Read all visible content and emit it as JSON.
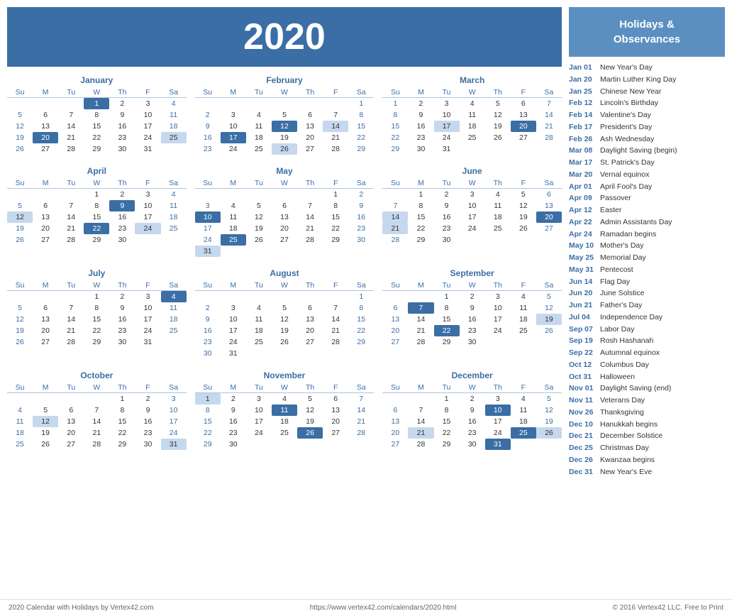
{
  "header": {
    "year": "2020"
  },
  "holidays_header": "Holidays &\nObservances",
  "holidays": [
    {
      "date": "Jan 01",
      "name": "New Year's Day"
    },
    {
      "date": "Jan 20",
      "name": "Martin Luther King Day"
    },
    {
      "date": "Jan 25",
      "name": "Chinese New Year"
    },
    {
      "date": "Feb 12",
      "name": "Lincoln's Birthday"
    },
    {
      "date": "Feb 14",
      "name": "Valentine's Day"
    },
    {
      "date": "Feb 17",
      "name": "President's Day"
    },
    {
      "date": "Feb 26",
      "name": "Ash Wednesday"
    },
    {
      "date": "Mar 08",
      "name": "Daylight Saving (begin)"
    },
    {
      "date": "Mar 17",
      "name": "St. Patrick's Day"
    },
    {
      "date": "Mar 20",
      "name": "Vernal equinox"
    },
    {
      "date": "Apr 01",
      "name": "April Fool's Day"
    },
    {
      "date": "Apr 09",
      "name": "Passover"
    },
    {
      "date": "Apr 12",
      "name": "Easter"
    },
    {
      "date": "Apr 22",
      "name": "Admin Assistants Day"
    },
    {
      "date": "Apr 24",
      "name": "Ramadan begins"
    },
    {
      "date": "May 10",
      "name": "Mother's Day"
    },
    {
      "date": "May 25",
      "name": "Memorial Day"
    },
    {
      "date": "May 31",
      "name": "Pentecost"
    },
    {
      "date": "Jun 14",
      "name": "Flag Day"
    },
    {
      "date": "Jun 20",
      "name": "June Solstice"
    },
    {
      "date": "Jun 21",
      "name": "Father's Day"
    },
    {
      "date": "Jul 04",
      "name": "Independence Day"
    },
    {
      "date": "Sep 07",
      "name": "Labor Day"
    },
    {
      "date": "Sep 19",
      "name": "Rosh Hashanah"
    },
    {
      "date": "Sep 22",
      "name": "Autumnal equinox"
    },
    {
      "date": "Oct 12",
      "name": "Columbus Day"
    },
    {
      "date": "Oct 31",
      "name": "Halloween"
    },
    {
      "date": "Nov 01",
      "name": "Daylight Saving (end)"
    },
    {
      "date": "Nov 11",
      "name": "Veterans Day"
    },
    {
      "date": "Nov 26",
      "name": "Thanksgiving"
    },
    {
      "date": "Dec 10",
      "name": "Hanukkah begins"
    },
    {
      "date": "Dec 21",
      "name": "December Solstice"
    },
    {
      "date": "Dec 25",
      "name": "Christmas Day"
    },
    {
      "date": "Dec 26",
      "name": "Kwanzaa begins"
    },
    {
      "date": "Dec 31",
      "name": "New Year's Eve"
    }
  ],
  "footer": {
    "left": "2020 Calendar with Holidays by Vertex42.com",
    "center": "https://www.vertex42.com/calendars/2020.html",
    "right": "© 2016 Vertex42 LLC. Free to Print"
  },
  "months": [
    {
      "name": "January",
      "weeks": [
        [
          "",
          "",
          "",
          "1",
          "2",
          "3",
          "4"
        ],
        [
          "5",
          "6",
          "7",
          "8",
          "9",
          "10",
          "11"
        ],
        [
          "12",
          "13",
          "14",
          "15",
          "16",
          "17",
          "18"
        ],
        [
          "19",
          "20",
          "21",
          "22",
          "23",
          "24",
          "25"
        ],
        [
          "26",
          "27",
          "28",
          "29",
          "30",
          "31",
          ""
        ]
      ],
      "highlights": {
        "1": "blue",
        "20": "blue",
        "25": "light"
      },
      "sundays": []
    },
    {
      "name": "February",
      "weeks": [
        [
          "",
          "",
          "",
          "",
          "",
          "",
          "1"
        ],
        [
          "2",
          "3",
          "4",
          "5",
          "6",
          "7",
          "8"
        ],
        [
          "9",
          "10",
          "11",
          "12",
          "13",
          "14",
          "15"
        ],
        [
          "16",
          "17",
          "18",
          "19",
          "20",
          "21",
          "22"
        ],
        [
          "23",
          "24",
          "25",
          "26",
          "27",
          "28",
          "29"
        ]
      ],
      "highlights": {
        "12": "blue",
        "14": "light",
        "17": "blue",
        "26": "light"
      }
    },
    {
      "name": "March",
      "weeks": [
        [
          "1",
          "2",
          "3",
          "4",
          "5",
          "6",
          "7"
        ],
        [
          "8",
          "9",
          "10",
          "11",
          "12",
          "13",
          "14"
        ],
        [
          "15",
          "16",
          "17",
          "18",
          "19",
          "20",
          "21"
        ],
        [
          "22",
          "23",
          "24",
          "25",
          "26",
          "27",
          "28"
        ],
        [
          "29",
          "30",
          "31",
          "",
          "",
          "",
          ""
        ]
      ],
      "highlights": {
        "17": "light",
        "20": "blue"
      }
    },
    {
      "name": "April",
      "weeks": [
        [
          "",
          "",
          "",
          "1",
          "2",
          "3",
          "4"
        ],
        [
          "5",
          "6",
          "7",
          "8",
          "9",
          "10",
          "11"
        ],
        [
          "12",
          "13",
          "14",
          "15",
          "16",
          "17",
          "18"
        ],
        [
          "19",
          "20",
          "21",
          "22",
          "23",
          "24",
          "25"
        ],
        [
          "26",
          "27",
          "28",
          "29",
          "30",
          "",
          ""
        ]
      ],
      "highlights": {
        "9": "blue",
        "12": "light",
        "22": "blue",
        "24": "light"
      }
    },
    {
      "name": "May",
      "weeks": [
        [
          "",
          "",
          "",
          "",
          "",
          "1",
          "2"
        ],
        [
          "3",
          "4",
          "5",
          "6",
          "7",
          "8",
          "9"
        ],
        [
          "10",
          "11",
          "12",
          "13",
          "14",
          "15",
          "16"
        ],
        [
          "17",
          "18",
          "19",
          "20",
          "21",
          "22",
          "23"
        ],
        [
          "24",
          "25",
          "26",
          "27",
          "28",
          "29",
          "30"
        ],
        [
          "31",
          "",
          "",
          "",
          "",
          "",
          ""
        ]
      ],
      "highlights": {
        "10": "blue",
        "25": "blue",
        "31": "light"
      }
    },
    {
      "name": "June",
      "weeks": [
        [
          "",
          "1",
          "2",
          "3",
          "4",
          "5",
          "6"
        ],
        [
          "7",
          "8",
          "9",
          "10",
          "11",
          "12",
          "13"
        ],
        [
          "14",
          "15",
          "16",
          "17",
          "18",
          "19",
          "20"
        ],
        [
          "21",
          "22",
          "23",
          "24",
          "25",
          "26",
          "27"
        ],
        [
          "28",
          "29",
          "30",
          "",
          "",
          "",
          ""
        ]
      ],
      "highlights": {
        "14": "light",
        "20": "blue",
        "21": "light"
      }
    },
    {
      "name": "July",
      "weeks": [
        [
          "",
          "",
          "",
          "1",
          "2",
          "3",
          "4"
        ],
        [
          "5",
          "6",
          "7",
          "8",
          "9",
          "10",
          "11"
        ],
        [
          "12",
          "13",
          "14",
          "15",
          "16",
          "17",
          "18"
        ],
        [
          "19",
          "20",
          "21",
          "22",
          "23",
          "24",
          "25"
        ],
        [
          "26",
          "27",
          "28",
          "29",
          "30",
          "31",
          ""
        ]
      ],
      "highlights": {
        "4": "blue"
      }
    },
    {
      "name": "August",
      "weeks": [
        [
          "",
          "",
          "",
          "",
          "",
          "",
          "1"
        ],
        [
          "2",
          "3",
          "4",
          "5",
          "6",
          "7",
          "8"
        ],
        [
          "9",
          "10",
          "11",
          "12",
          "13",
          "14",
          "15"
        ],
        [
          "16",
          "17",
          "18",
          "19",
          "20",
          "21",
          "22"
        ],
        [
          "23",
          "24",
          "25",
          "26",
          "27",
          "28",
          "29"
        ],
        [
          "30",
          "31",
          "",
          "",
          "",
          "",
          ""
        ]
      ],
      "highlights": {}
    },
    {
      "name": "September",
      "weeks": [
        [
          "",
          "",
          "1",
          "2",
          "3",
          "4",
          "5"
        ],
        [
          "6",
          "7",
          "8",
          "9",
          "10",
          "11",
          "12"
        ],
        [
          "13",
          "14",
          "15",
          "16",
          "17",
          "18",
          "19"
        ],
        [
          "20",
          "21",
          "22",
          "23",
          "24",
          "25",
          "26"
        ],
        [
          "27",
          "28",
          "29",
          "30",
          "",
          "",
          ""
        ]
      ],
      "highlights": {
        "7": "blue",
        "19": "light",
        "22": "blue"
      }
    },
    {
      "name": "October",
      "weeks": [
        [
          "",
          "",
          "",
          "",
          "1",
          "2",
          "3"
        ],
        [
          "4",
          "5",
          "6",
          "7",
          "8",
          "9",
          "10"
        ],
        [
          "11",
          "12",
          "13",
          "14",
          "15",
          "16",
          "17"
        ],
        [
          "18",
          "19",
          "20",
          "21",
          "22",
          "23",
          "24"
        ],
        [
          "25",
          "26",
          "27",
          "28",
          "29",
          "30",
          "31"
        ]
      ],
      "highlights": {
        "12": "light",
        "31": "light"
      }
    },
    {
      "name": "November",
      "weeks": [
        [
          "1",
          "2",
          "3",
          "4",
          "5",
          "6",
          "7"
        ],
        [
          "8",
          "9",
          "10",
          "11",
          "12",
          "13",
          "14"
        ],
        [
          "15",
          "16",
          "17",
          "18",
          "19",
          "20",
          "21"
        ],
        [
          "22",
          "23",
          "24",
          "25",
          "26",
          "27",
          "28"
        ],
        [
          "29",
          "30",
          "",
          "",
          "",
          "",
          ""
        ]
      ],
      "highlights": {
        "1": "light",
        "11": "blue",
        "26": "blue"
      }
    },
    {
      "name": "December",
      "weeks": [
        [
          "",
          "",
          "1",
          "2",
          "3",
          "4",
          "5"
        ],
        [
          "6",
          "7",
          "8",
          "9",
          "10",
          "11",
          "12"
        ],
        [
          "13",
          "14",
          "15",
          "16",
          "17",
          "18",
          "19"
        ],
        [
          "20",
          "21",
          "22",
          "23",
          "24",
          "25",
          "26"
        ],
        [
          "27",
          "28",
          "29",
          "30",
          "31",
          "",
          ""
        ]
      ],
      "highlights": {
        "10": "blue",
        "21": "light",
        "25": "blue",
        "26": "light",
        "31": "blue"
      }
    }
  ],
  "days_header": [
    "Su",
    "M",
    "Tu",
    "W",
    "Th",
    "F",
    "Sa"
  ]
}
